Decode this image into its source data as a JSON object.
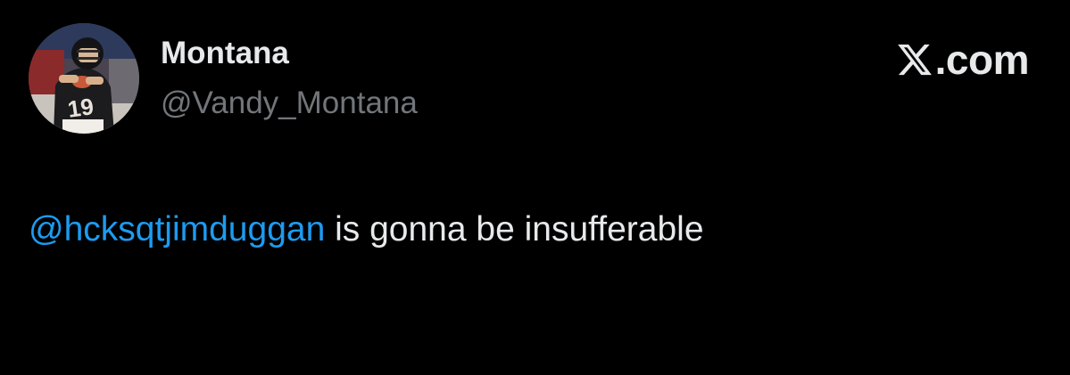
{
  "author": {
    "display_name": "Montana",
    "handle": "@Vandy_Montana",
    "avatar_icon": "profile-photo-football-player"
  },
  "brand": {
    "icon": "x-logo-icon",
    "text": ".com"
  },
  "tweet": {
    "mention": "@hcksqtjimduggan",
    "body": " is gonna be insufferable"
  },
  "colors": {
    "background": "#000000",
    "primary_text": "#e7e9ea",
    "secondary_text": "#71767b",
    "link": "#1d9bf0"
  }
}
